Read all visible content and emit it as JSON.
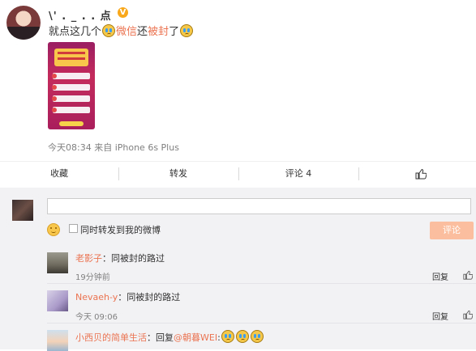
{
  "post": {
    "username": "\\' . _ . . 点",
    "vip_badge": "V",
    "text_prefix": "就点这几个",
    "text_red1": "微信",
    "text_mid": "还",
    "text_red2": "被封",
    "text_suffix": "了",
    "meta": "今天08:34 来自 iPhone 6s Plus"
  },
  "actions": {
    "favorite": "收藏",
    "forward": "转发",
    "comment": "评论 4",
    "like_icon": "thumbs-up-icon"
  },
  "composer": {
    "forward_checkbox_label": "同时转发到我的微博",
    "submit_label": "评论",
    "emoji_icon": "smile-icon"
  },
  "comments": [
    {
      "name": "老影子",
      "text": "：同被封的路过",
      "time": "19分钟前",
      "reply_label": "回复"
    },
    {
      "name": "Nevaeh-y",
      "text": "：同被封的路过",
      "time": "今天 09:06",
      "reply_label": "回复"
    },
    {
      "name": "小西贝的简单生活",
      "text": "：回复",
      "mention": "@朝暮WEI",
      "colon": ":"
    }
  ],
  "colors": {
    "accent": "#eb7350",
    "submit_disabled": "#fbbf9f",
    "comment_bg": "#f2f2f5"
  }
}
